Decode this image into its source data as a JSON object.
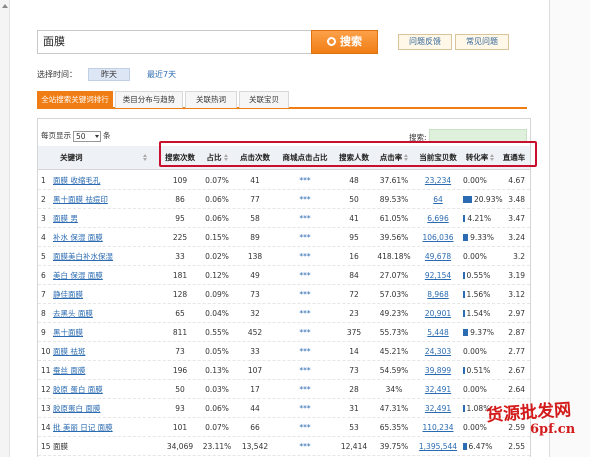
{
  "search": {
    "query": "面膜",
    "button_label": "搜索"
  },
  "actions": {
    "feedback": "问题反馈",
    "faq": "常见问题"
  },
  "time": {
    "label": "选择时间：",
    "yesterday": "昨天",
    "last7": "最近7天"
  },
  "tabs": [
    "全站搜索关键词排行",
    "类目分布与趋势",
    "关联热词",
    "关联宝贝"
  ],
  "pager": {
    "prefix": "每页显示",
    "value": "50",
    "suffix": "条"
  },
  "search_label": "搜索:",
  "columns": [
    "关键词",
    "搜索次数",
    "占比",
    "点击次数",
    "商城点击占比",
    "搜索人数",
    "点击率",
    "当前宝贝数",
    "转化率",
    "直通车"
  ],
  "accent_colors": {
    "orange": "#f07d14",
    "link": "#2b6bb1",
    "highlight": "#c8102e"
  },
  "rows": [
    {
      "idx": "1",
      "kw": "面膜 收缩毛孔",
      "search": "109",
      "pct": "0.07%",
      "clicks": "41",
      "mall": "***",
      "people": "48",
      "ctr": "37.61%",
      "items": "23,234",
      "conv": "0.00%",
      "conv_val": 0,
      "ztc": "4.67"
    },
    {
      "idx": "2",
      "kw": "黑十面膜 祛痘印",
      "search": "86",
      "pct": "0.06%",
      "clicks": "77",
      "mall": "***",
      "people": "50",
      "ctr": "89.53%",
      "items": "64",
      "conv": "20.93%",
      "conv_val": 20.93,
      "ztc": "3.48"
    },
    {
      "idx": "3",
      "kw": "面膜 男",
      "search": "95",
      "pct": "0.06%",
      "clicks": "58",
      "mall": "***",
      "people": "41",
      "ctr": "61.05%",
      "items": "6,696",
      "conv": "4.21%",
      "conv_val": 4.21,
      "ztc": "3.47"
    },
    {
      "idx": "4",
      "kw": "补水 保湿 面膜",
      "search": "225",
      "pct": "0.15%",
      "clicks": "89",
      "mall": "***",
      "people": "95",
      "ctr": "39.56%",
      "items": "106,036",
      "conv": "9.33%",
      "conv_val": 9.33,
      "ztc": "3.24"
    },
    {
      "idx": "5",
      "kw": "面膜美白补水保湿",
      "search": "33",
      "pct": "0.02%",
      "clicks": "138",
      "mall": "***",
      "people": "16",
      "ctr": "418.18%",
      "items": "49,678",
      "conv": "0.00%",
      "conv_val": 0,
      "ztc": "3.2"
    },
    {
      "idx": "6",
      "kw": "美白 保湿 面膜",
      "search": "181",
      "pct": "0.12%",
      "clicks": "49",
      "mall": "***",
      "people": "84",
      "ctr": "27.07%",
      "items": "92,154",
      "conv": "0.55%",
      "conv_val": 0.55,
      "ztc": "3.19"
    },
    {
      "idx": "7",
      "kw": "静佳面膜",
      "search": "128",
      "pct": "0.09%",
      "clicks": "73",
      "mall": "***",
      "people": "72",
      "ctr": "57.03%",
      "items": "8,968",
      "conv": "1.56%",
      "conv_val": 1.56,
      "ztc": "3.12"
    },
    {
      "idx": "8",
      "kw": "去黑头 面膜",
      "search": "65",
      "pct": "0.04%",
      "clicks": "32",
      "mall": "***",
      "people": "23",
      "ctr": "49.23%",
      "items": "20,901",
      "conv": "1.54%",
      "conv_val": 1.54,
      "ztc": "2.97"
    },
    {
      "idx": "9",
      "kw": "黑十面膜",
      "search": "811",
      "pct": "0.55%",
      "clicks": "452",
      "mall": "***",
      "people": "375",
      "ctr": "55.73%",
      "items": "5,448",
      "conv": "9.37%",
      "conv_val": 9.37,
      "ztc": "2.87"
    },
    {
      "idx": "10",
      "kw": "面膜 祛斑",
      "search": "73",
      "pct": "0.05%",
      "clicks": "33",
      "mall": "***",
      "people": "14",
      "ctr": "45.21%",
      "items": "24,303",
      "conv": "0.00%",
      "conv_val": 0,
      "ztc": "2.77"
    },
    {
      "idx": "11",
      "kw": "蚕丝 面膜",
      "search": "196",
      "pct": "0.13%",
      "clicks": "107",
      "mall": "***",
      "people": "73",
      "ctr": "54.59%",
      "items": "39,899",
      "conv": "0.51%",
      "conv_val": 0.51,
      "ztc": "2.67"
    },
    {
      "idx": "12",
      "kw": "胶原 蛋白 面膜",
      "search": "50",
      "pct": "0.03%",
      "clicks": "17",
      "mall": "***",
      "people": "28",
      "ctr": "34%",
      "items": "32,491",
      "conv": "0.00%",
      "conv_val": 0,
      "ztc": "2.64"
    },
    {
      "idx": "13",
      "kw": "胶原蛋白 面膜",
      "search": "93",
      "pct": "0.06%",
      "clicks": "44",
      "mall": "***",
      "people": "31",
      "ctr": "47.31%",
      "items": "32,491",
      "conv": "1.08%",
      "conv_val": 1.08,
      "ztc": ""
    },
    {
      "idx": "14",
      "kw": "批 美丽 日记 面膜",
      "search": "101",
      "pct": "0.07%",
      "clicks": "66",
      "mall": "***",
      "people": "53",
      "ctr": "65.35%",
      "items": "110,234",
      "conv": "0.00%",
      "conv_val": 0,
      "ztc": "2.59"
    },
    {
      "idx": "15",
      "kw": "面膜",
      "search": "34,069",
      "pct": "23.11%",
      "clicks": "13,542",
      "mall": "***",
      "people": "12,414",
      "ctr": "39.75%",
      "items": "1,395,544",
      "conv": "6.47%",
      "conv_val": 6.47,
      "ztc": "2.55"
    }
  ],
  "watermark": {
    "line1": "货源批发网",
    "line2": "6pf.cn"
  }
}
